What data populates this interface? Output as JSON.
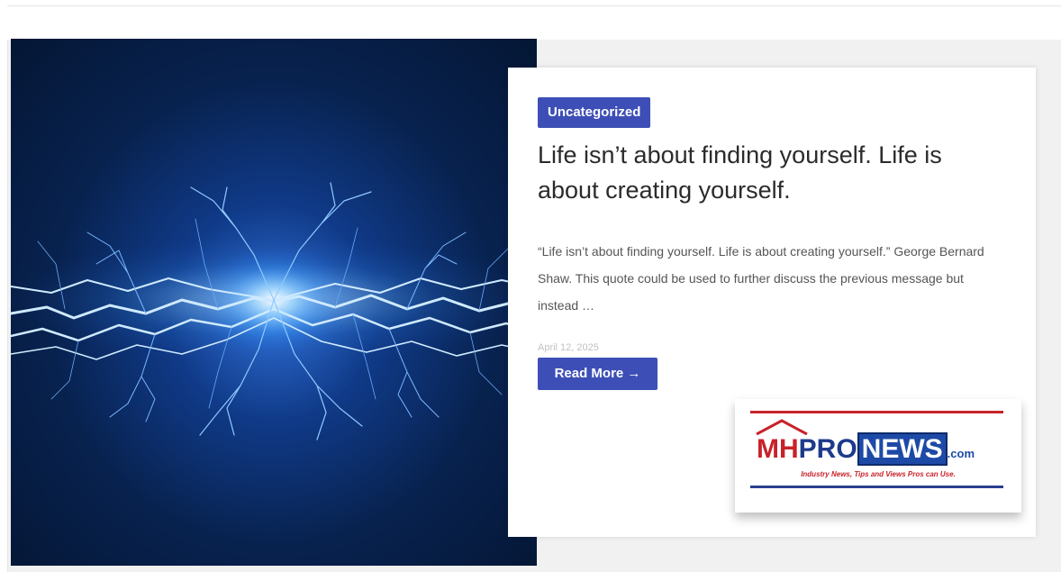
{
  "post": {
    "category": "Uncategorized",
    "title": "Life isn’t about finding yourself. Life is about creating yourself.",
    "excerpt": "“Life isn’t about finding yourself. Life is about creating yourself.” George Bernard Shaw. This quote could be used to further discuss the previous message but instead …",
    "date": "April 12, 2025",
    "read_more": "Read More →"
  },
  "logo": {
    "mh": "MH",
    "pro": "PRO",
    "news": "NEWS",
    "com": ".com",
    "tagline": "Industry News, Tips and Views Pros can Use."
  },
  "colors": {
    "accent": "#3d4fb6",
    "logo_red": "#c8222a",
    "logo_blue": "#1d4aa6"
  },
  "icons": {
    "hero": "electric-lightning-image",
    "logo_house": "house-roof-icon"
  }
}
